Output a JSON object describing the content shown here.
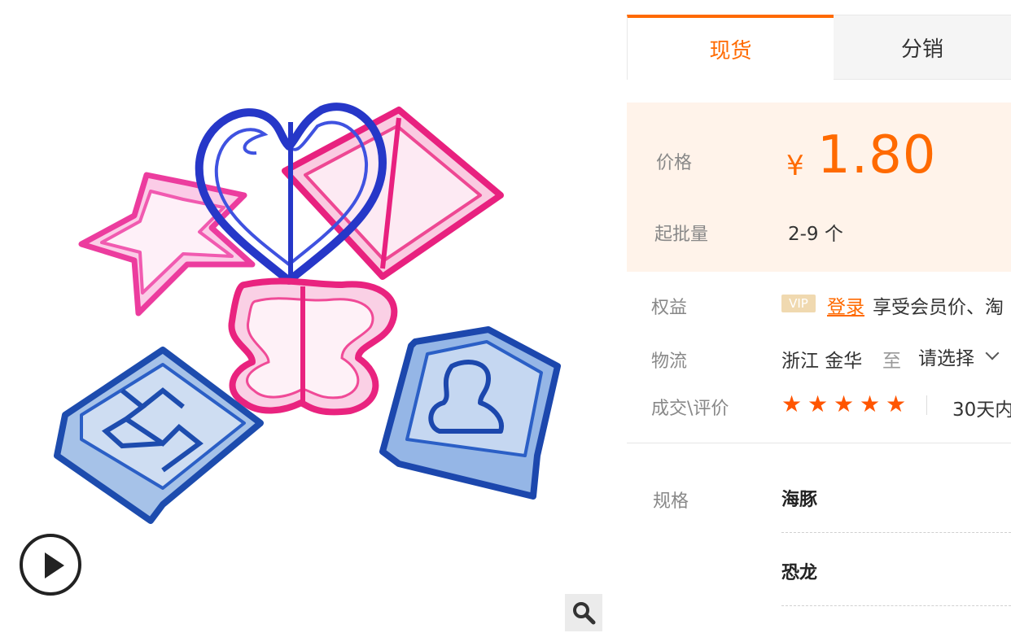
{
  "tabs": {
    "active": "现货",
    "inactive": "分销"
  },
  "price": {
    "label": "价格",
    "currency": "¥",
    "value": "1.80",
    "moq_label": "起批量",
    "moq_value": "2-9 个"
  },
  "rights": {
    "label": "权益",
    "badge": "VIP",
    "login": "登录",
    "text": "享受会员价、淘"
  },
  "logistics": {
    "label": "物流",
    "from": "浙江 金华",
    "to": "至",
    "select": "请选择"
  },
  "deal": {
    "label": "成交\\评价",
    "rating": 5,
    "rating_max": 5,
    "sales": "30天内"
  },
  "spec": {
    "label": "规格",
    "options": [
      "海豚",
      "恐龙"
    ]
  },
  "colors": {
    "accent": "#ff6a00",
    "price_bg": "#fff3ea",
    "star": "#ff5500"
  }
}
